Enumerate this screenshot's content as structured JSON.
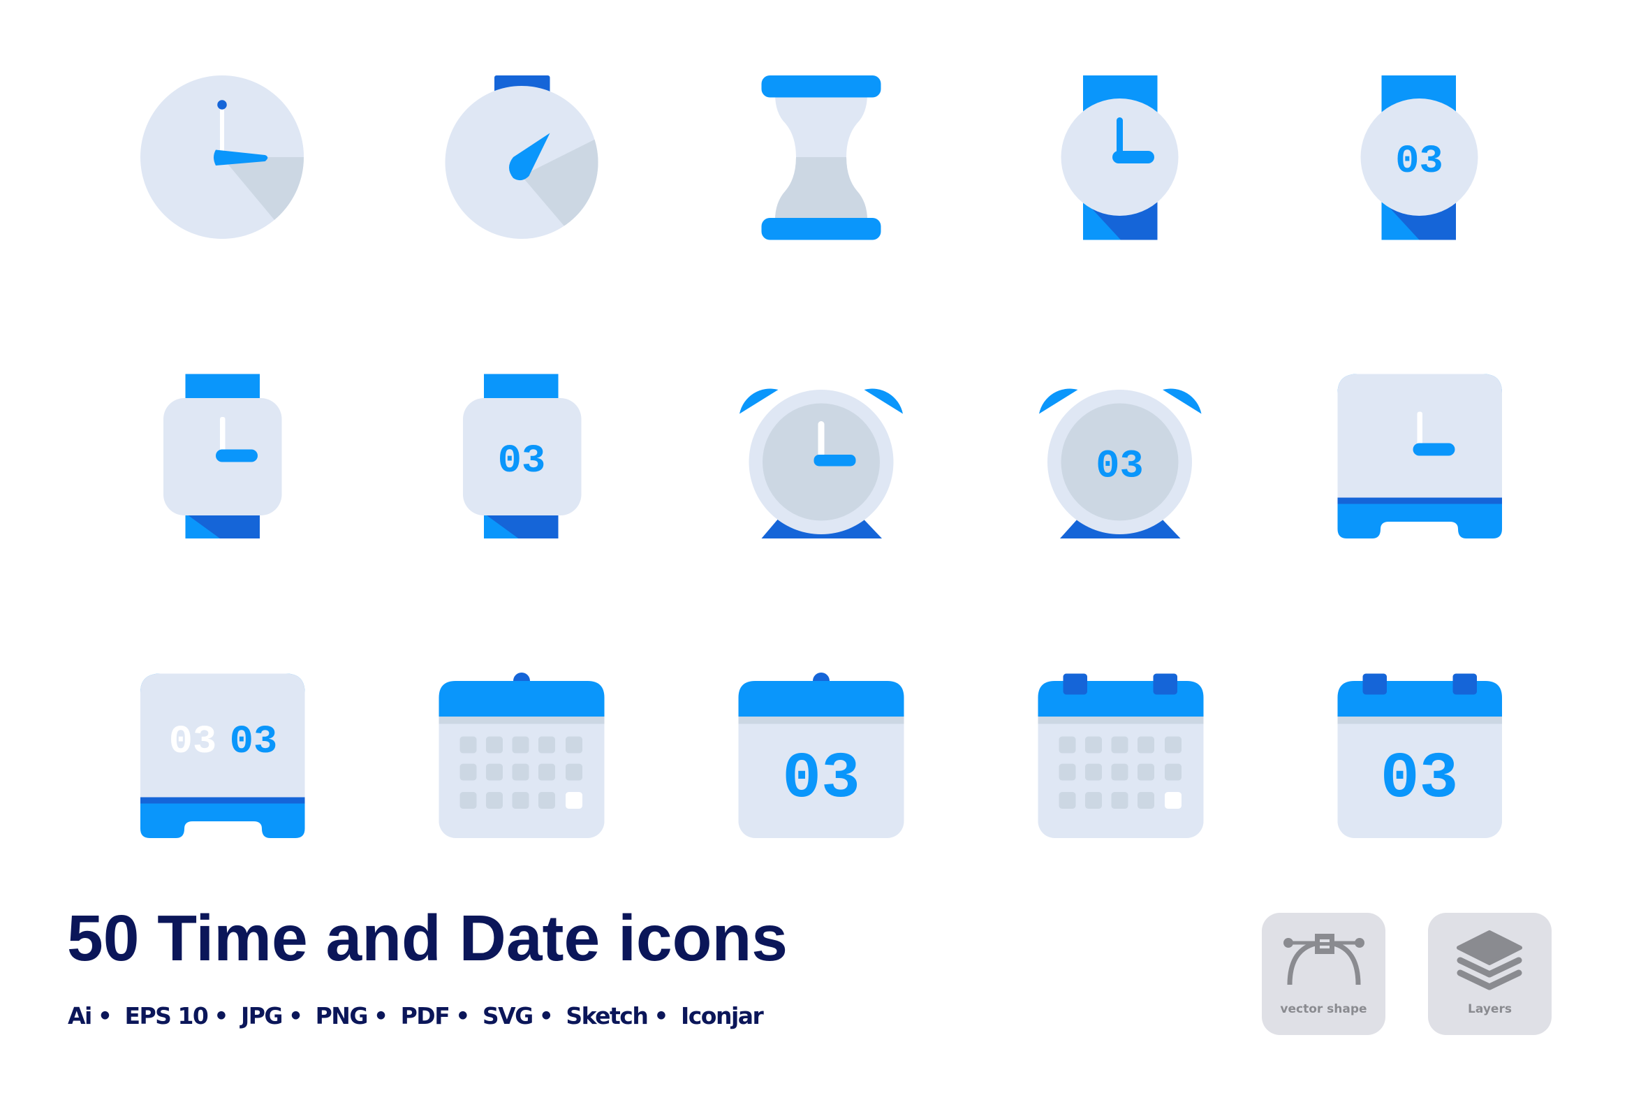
{
  "title": "50 Time and Date icons",
  "formats": [
    "Ai",
    "EPS 10",
    "JPG",
    "PNG",
    "PDF",
    "SVG",
    "Sketch",
    "Iconjar"
  ],
  "badges": [
    {
      "label": "vector shape",
      "icon": "vector-shape-icon"
    },
    {
      "label": "Layers",
      "icon": "layers-icon"
    }
  ],
  "colors": {
    "primary_blue": "#0a96fb",
    "dark_blue": "#1565d8",
    "light_face": "#dfe7f4",
    "shadow_gray": "#ccd7e3",
    "title_navy": "#0b1659",
    "badge_bg": "#dfe0e6",
    "badge_fg": "#8a8b90"
  },
  "icons": [
    {
      "name": "clock-icon"
    },
    {
      "name": "stopwatch-icon"
    },
    {
      "name": "hourglass-icon"
    },
    {
      "name": "wristwatch-analog-icon"
    },
    {
      "name": "wristwatch-digital-icon",
      "digits": "03"
    },
    {
      "name": "smartwatch-analog-icon"
    },
    {
      "name": "smartwatch-digital-icon",
      "digits": "03"
    },
    {
      "name": "alarm-clock-analog-icon"
    },
    {
      "name": "alarm-clock-digital-icon",
      "digits": "03"
    },
    {
      "name": "desk-clock-analog-icon"
    },
    {
      "name": "desk-clock-digital-icon",
      "digits_dim": "03",
      "digits": "03"
    },
    {
      "name": "calendar-grid-icon"
    },
    {
      "name": "calendar-date-icon",
      "digits": "03"
    },
    {
      "name": "calendar-rings-grid-icon"
    },
    {
      "name": "calendar-rings-date-icon",
      "digits": "03"
    }
  ]
}
